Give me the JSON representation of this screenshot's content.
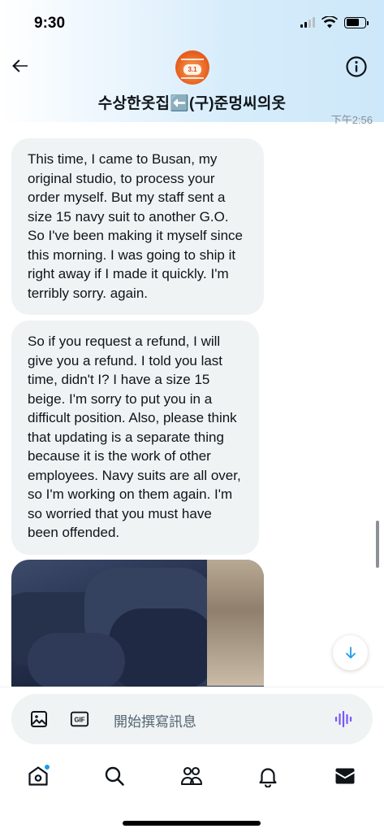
{
  "status_bar": {
    "time": "9:30"
  },
  "header": {
    "title": "수상한옷집⬅️(구)준멍씨의옷",
    "avatar_badge": "3.1",
    "timestamp_peek": "下午2:56"
  },
  "messages": [
    {
      "text": "This time, I came to Busan, my original studio, to process your order myself. But my staff sent a size 15 navy suit to another G.O. So I've been making it myself since this morning. I was going to ship it right away if I made it quickly. I'm terribly sorry. again."
    },
    {
      "text": "So if you request a refund, I will give you a refund. I told you last time, didn't I? I have a size 15 beige. I'm sorry to put you in a difficult position. Also, please think that updating is a separate thing because it is the work of other employees. Navy suits are all over, so I'm working on them again. I'm so worried that you must have been offended."
    }
  ],
  "composer": {
    "placeholder": "開始撰寫訊息",
    "gif_label": "GIF"
  },
  "colors": {
    "accent": "#1d9bf0",
    "bubble": "#eff3f4",
    "voice_icon": "#7856ff"
  },
  "nav": [
    "home-icon",
    "search-icon",
    "communities-icon",
    "notifications-icon",
    "messages-icon"
  ]
}
